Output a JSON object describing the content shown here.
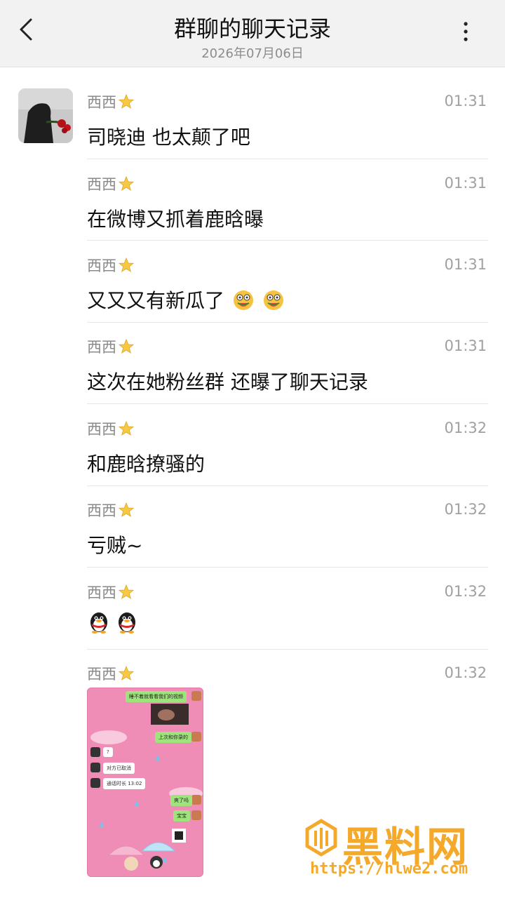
{
  "header": {
    "title": "群聊的聊天记录",
    "date": "2026年07月06日",
    "back_icon": "chevron-left-icon",
    "menu_icon": "more-vertical-icon"
  },
  "sender": {
    "name": "西西"
  },
  "messages": [
    {
      "time": "01:31",
      "text": "司晓迪 也太颠了吧"
    },
    {
      "time": "01:31",
      "text": "在微博又抓着鹿晗曝"
    },
    {
      "time": "01:31",
      "text": "又又又有新瓜了"
    },
    {
      "time": "01:31",
      "text": "这次在她粉丝群 还曝了聊天记录"
    },
    {
      "time": "01:32",
      "text": "和鹿晗撩骚的"
    },
    {
      "time": "01:32",
      "text": "亏贼~"
    },
    {
      "time": "01:32",
      "text": ""
    },
    {
      "time": "01:32",
      "text": ""
    }
  ],
  "screenshot_bubbles": {
    "b1": "睡不着就看看我们的视频",
    "b2": "上次和你录的",
    "b3": "?",
    "b4": "对方已取消",
    "b5": "通话时长 13:02",
    "b6": "爽了吗",
    "b7": "宝宝"
  },
  "watermark": {
    "brand": "黑料网",
    "url": "https://hlwe2.com"
  },
  "colors": {
    "header_bg": "#f2f2f2",
    "watermark": "#f4a92a",
    "screenshot_bg": "#ef8db7"
  }
}
